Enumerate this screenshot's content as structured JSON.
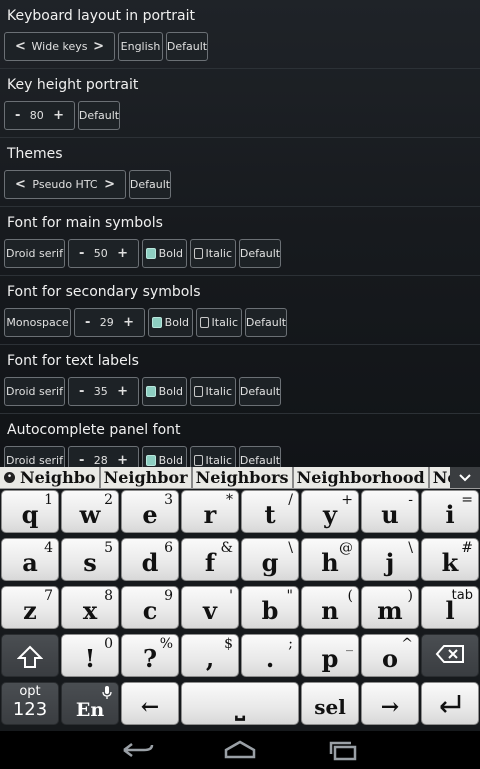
{
  "settings": {
    "sections": [
      {
        "title": "Keyboard layout in portrait",
        "selector": "Wide keys",
        "english": "English",
        "default": "Default"
      },
      {
        "title": "Key height portrait",
        "value": "80",
        "default": "Default"
      },
      {
        "title": "Themes",
        "selector": "Pseudo HTC",
        "default": "Default"
      },
      {
        "title": "Font for main symbols",
        "font": "Droid serif",
        "size": "50",
        "bold": "Bold",
        "italic": "Italic",
        "default": "Default",
        "bold_checked": true,
        "italic_checked": false
      },
      {
        "title": "Font for secondary symbols",
        "font": "Monospace",
        "size": "29",
        "bold": "Bold",
        "italic": "Italic",
        "default": "Default",
        "bold_checked": true,
        "italic_checked": false
      },
      {
        "title": "Font for text labels",
        "font": "Droid serif",
        "size": "35",
        "bold": "Bold",
        "italic": "Italic",
        "default": "Default",
        "bold_checked": true,
        "italic_checked": false
      },
      {
        "title": "Autocomplete panel font",
        "font": "Droid serif",
        "size": "28",
        "bold": "Bold",
        "italic": "Italic",
        "default": "Default",
        "bold_checked": true,
        "italic_checked": false
      }
    ],
    "prev": "<",
    "next": ">",
    "minus": "-",
    "plus": "+"
  },
  "suggestions": {
    "bullet": "•",
    "items": [
      "Neighbo",
      "Neighbor",
      "Neighbors",
      "Neighborhood",
      "Neigh"
    ],
    "expand_icon": "chevron-down-icon"
  },
  "keyboard": {
    "rows": [
      [
        {
          "m": "q",
          "s": "1"
        },
        {
          "m": "w",
          "s": "2"
        },
        {
          "m": "e",
          "s": "3"
        },
        {
          "m": "r",
          "s": "*"
        },
        {
          "m": "t",
          "s": "/"
        },
        {
          "m": "y",
          "s": "+"
        },
        {
          "m": "u",
          "s": "-"
        },
        {
          "m": "i",
          "s": "="
        }
      ],
      [
        {
          "m": "a",
          "s": "4"
        },
        {
          "m": "s",
          "s": "5"
        },
        {
          "m": "d",
          "s": "6"
        },
        {
          "m": "f",
          "s": "&"
        },
        {
          "m": "g",
          "s": "\\"
        },
        {
          "m": "h",
          "s": "@"
        },
        {
          "m": "j",
          "s": "\\"
        },
        {
          "m": "k",
          "s": "#"
        }
      ],
      [
        {
          "m": "z",
          "s": "7"
        },
        {
          "m": "x",
          "s": "8"
        },
        {
          "m": "c",
          "s": "9"
        },
        {
          "m": "v",
          "s": "'"
        },
        {
          "m": "b",
          "s": "\""
        },
        {
          "m": "n",
          "s": "("
        },
        {
          "m": "m",
          "s": ")"
        },
        {
          "m": "l",
          "s": "tab"
        }
      ],
      [
        {
          "m": "",
          "s": "",
          "icon": "shift-icon"
        },
        {
          "m": "!",
          "s": "0"
        },
        {
          "m": "?",
          "s": "%"
        },
        {
          "m": ",",
          "s": "$"
        },
        {
          "m": ".",
          "s": ";"
        },
        {
          "m": "p",
          "s": "_"
        },
        {
          "m": "o",
          "s": "^"
        },
        {
          "m": "",
          "s": "",
          "icon": "backspace-icon"
        }
      ],
      [
        {
          "m": "123",
          "s": "opt",
          "icon": "opt-123-icon"
        },
        {
          "m": "En",
          "s": "",
          "icon": "mic-icon"
        },
        {
          "m": "←",
          "s": ""
        },
        {
          "m": "⎵",
          "s": "",
          "wide": true
        },
        {
          "m": "sel",
          "s": ""
        },
        {
          "m": "→",
          "s": ""
        },
        {
          "m": "",
          "s": "",
          "icon": "enter-icon"
        }
      ]
    ]
  },
  "navbar": {
    "back": "back-icon",
    "home": "home-icon",
    "recents": "recents-icon"
  }
}
